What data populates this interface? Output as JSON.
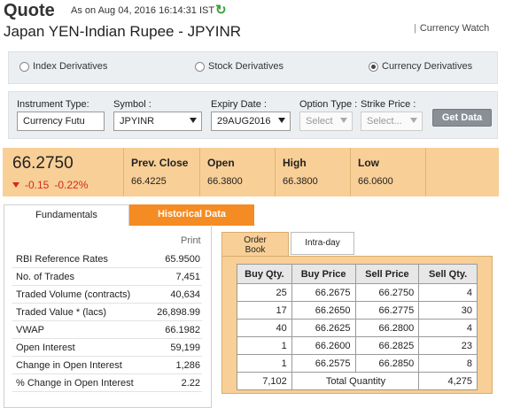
{
  "header": {
    "title": "Quote",
    "as_on": "As on Aug 04, 2016 16:14:31 IST",
    "pair_title": "Japan YEN-Indian Rupee - JPYINR",
    "currency_watch": "Currency Watch"
  },
  "segments": [
    {
      "label": "Index Derivatives",
      "selected": false
    },
    {
      "label": "Stock Derivatives",
      "selected": false
    },
    {
      "label": "Currency Derivatives",
      "selected": true
    }
  ],
  "filters": {
    "instrument_label": "Instrument Type:",
    "instrument_value": "Currency Futu",
    "symbol_label": "Symbol :",
    "symbol_value": "JPYINR",
    "expiry_label": "Expiry Date :",
    "expiry_value": "29AUG2016",
    "option_label": "Option Type :",
    "option_value": "Select",
    "strike_label": "Strike Price :",
    "strike_value": "Select...",
    "get_data": "Get Data"
  },
  "price": {
    "last": "66.2750",
    "change": "-0.15",
    "change_pct": "-0.22%",
    "prev_close_label": "Prev. Close",
    "prev_close": "66.4225",
    "open_label": "Open",
    "open": "66.3800",
    "high_label": "High",
    "high": "66.3800",
    "low_label": "Low",
    "low": "66.0600"
  },
  "tabs": {
    "fundamentals": "Fundamentals",
    "historical": "Historical Data"
  },
  "fundamentals": {
    "print": "Print",
    "rows": [
      {
        "label": "RBI Reference Rates",
        "value": "65.9500"
      },
      {
        "label": "No. of Trades",
        "value": "7,451"
      },
      {
        "label": "Traded Volume (contracts)",
        "value": "40,634"
      },
      {
        "label": "Traded Value * (lacs)",
        "value": "26,898.99"
      },
      {
        "label": "VWAP",
        "value": "66.1982"
      },
      {
        "label": "Open Interest",
        "value": "59,199"
      },
      {
        "label": "Change in Open Interest",
        "value": "1,286"
      },
      {
        "label": "% Change in Open Interest",
        "value": "2.22"
      }
    ]
  },
  "orderbook": {
    "tab_order_book_1": "Order",
    "tab_order_book_2": "Book",
    "tab_intraday": "Intra-day",
    "headers": [
      "Buy Qty.",
      "Buy Price",
      "Sell Price",
      "Sell Qty."
    ],
    "rows": [
      [
        "25",
        "66.2675",
        "66.2750",
        "4"
      ],
      [
        "17",
        "66.2650",
        "66.2775",
        "30"
      ],
      [
        "40",
        "66.2625",
        "66.2800",
        "4"
      ],
      [
        "1",
        "66.2600",
        "66.2825",
        "23"
      ],
      [
        "1",
        "66.2575",
        "66.2850",
        "8"
      ]
    ],
    "total_buy": "7,102",
    "total_label": "Total Quantity",
    "total_sell": "4,275"
  },
  "colors": {
    "accent_orange": "#f58b23",
    "strip_peach": "#f8cf96",
    "negative_red": "#d12a1e",
    "refresh_green": "#3aa03a"
  }
}
